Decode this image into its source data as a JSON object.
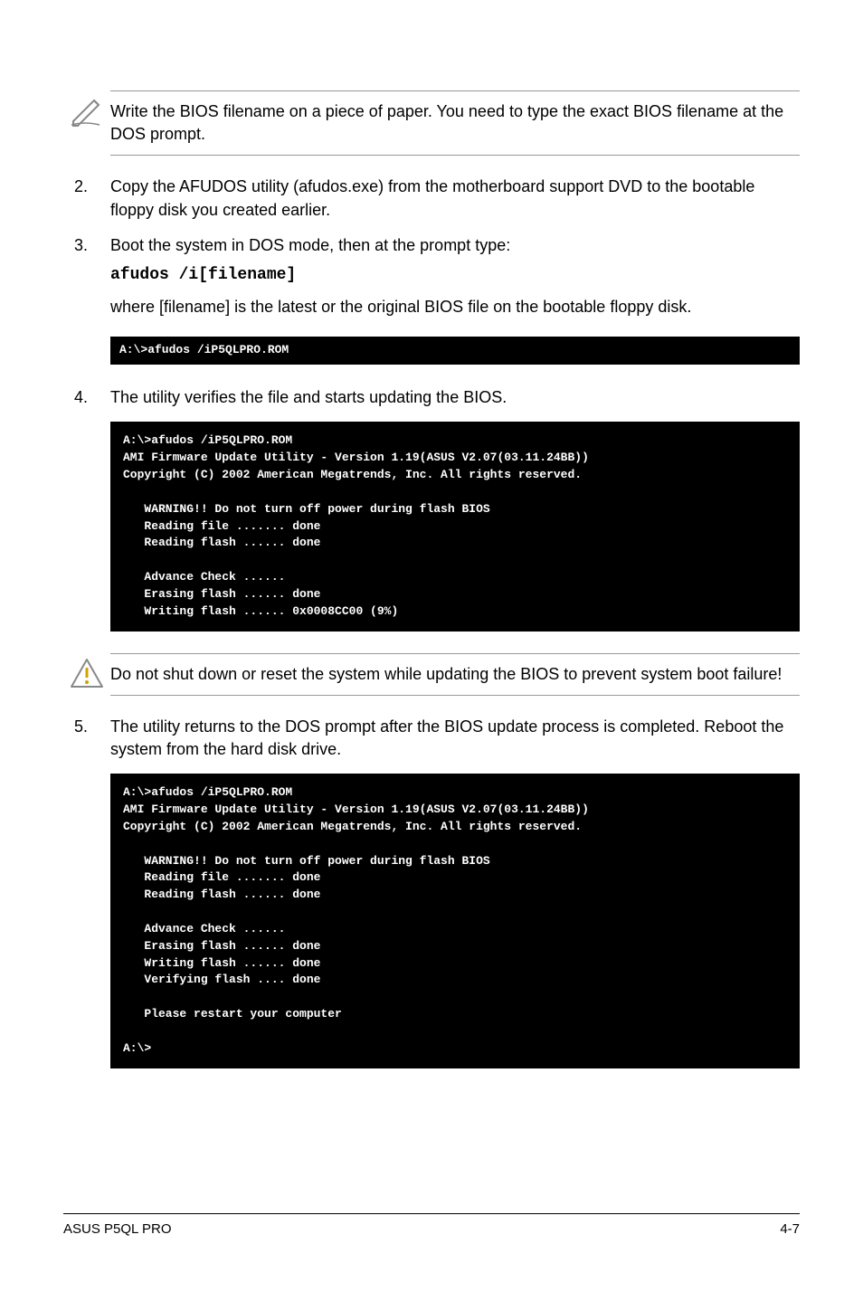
{
  "callout1": {
    "text": "Write the BIOS filename on a piece of paper. You need to type the exact BIOS filename at the DOS prompt."
  },
  "steps": {
    "s2": {
      "num": "2.",
      "text": "Copy the AFUDOS utility (afudos.exe) from the motherboard support DVD to the bootable floppy disk you created earlier."
    },
    "s3": {
      "num": "3.",
      "text1": "Boot the system in DOS mode, then at the prompt type:",
      "cmd": "afudos /i[filename]",
      "text2": "where [filename] is the latest or the original BIOS file on the bootable floppy disk."
    },
    "s4": {
      "num": "4.",
      "text": "The utility verifies the file and starts updating the BIOS."
    },
    "s5": {
      "num": "5.",
      "text": "The utility returns to the DOS prompt after the BIOS update process is completed. Reboot the system from the hard disk drive."
    }
  },
  "term1": "A:\\>afudos /iP5QLPRO.ROM",
  "term2": "A:\\>afudos /iP5QLPRO.ROM\nAMI Firmware Update Utility - Version 1.19(ASUS V2.07(03.11.24BB))\nCopyright (C) 2002 American Megatrends, Inc. All rights reserved.\n\n   WARNING!! Do not turn off power during flash BIOS\n   Reading file ....... done\n   Reading flash ...... done\n\n   Advance Check ......\n   Erasing flash ...... done\n   Writing flash ...... 0x0008CC00 (9%)\n",
  "callout2": {
    "text": "Do not shut down or reset the system while updating the BIOS to prevent system boot failure!"
  },
  "term3": "A:\\>afudos /iP5QLPRO.ROM\nAMI Firmware Update Utility - Version 1.19(ASUS V2.07(03.11.24BB))\nCopyright (C) 2002 American Megatrends, Inc. All rights reserved.\n\n   WARNING!! Do not turn off power during flash BIOS\n   Reading file ....... done\n   Reading flash ...... done\n\n   Advance Check ......\n   Erasing flash ...... done\n   Writing flash ...... done\n   Verifying flash .... done\n\n   Please restart your computer\n\nA:\\>",
  "footer": {
    "left": "ASUS P5QL PRO",
    "right": "4-7"
  }
}
